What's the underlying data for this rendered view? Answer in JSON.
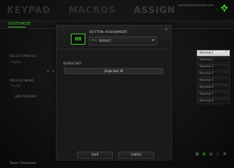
{
  "app": {
    "tabs": [
      "KEYPAD",
      "MACROS",
      "ASSIGN"
    ],
    "account_email": "someaddress@email.com",
    "subtab": "CUSTOMIZE",
    "window_controls": "_ ?",
    "accent_color": "#44d62c"
  },
  "sidebar": {
    "select_profile_label": "SELECT PROFILE",
    "select_profile_value": "Profile",
    "profile_dots": "• • •",
    "profile_name_label": "PROFILE NAME",
    "profile_name_value": "Profile",
    "link_program_label": "LINK PROGRAM"
  },
  "keymaps": [
    {
      "label": "Keymap 1",
      "glyph": "^"
    },
    {
      "label": "Keymap 2",
      "glyph": ""
    },
    {
      "label": "Keymap 3",
      "glyph": "-"
    },
    {
      "label": "Keymap 4",
      "glyph": "^"
    },
    {
      "label": "Keymap 5",
      "glyph": "-"
    },
    {
      "label": "Keymap 6",
      "glyph": "^"
    },
    {
      "label": "Keymap 7",
      "glyph": "-"
    },
    {
      "label": "Keymap 8",
      "glyph": ""
    }
  ],
  "footer": {
    "device_name": "Razer Orbweaver",
    "icons": [
      "app-icon-1",
      "app-icon-2",
      "app-icon-3",
      "app-icon-4",
      "app-icon-5"
    ]
  },
  "dialog": {
    "key_number": "08",
    "title": "BUTTON ASSIGNMENT",
    "assignment_value": "DEFAULT",
    "close_glyph": "x",
    "field_label": "DEFAULT KEY",
    "field_value": "Single Key: W",
    "save_label": "SAVE",
    "cancel_label": "CANCEL"
  }
}
